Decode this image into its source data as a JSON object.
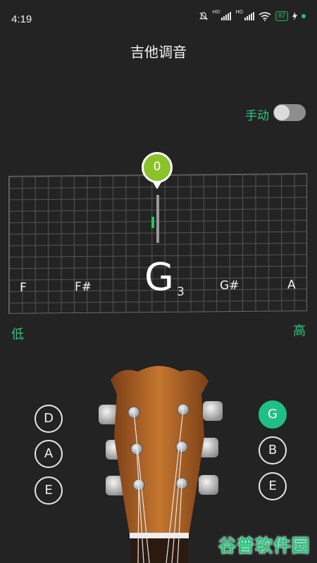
{
  "status": {
    "time": "4:19",
    "hd1": "HD",
    "hd2": "HD",
    "battery": "87"
  },
  "page": {
    "title": "吉他调音"
  },
  "mode": {
    "manual_label": "手动",
    "manual_enabled": false
  },
  "tuner": {
    "cents_offset": "0",
    "notes": [
      "F",
      "F#",
      "G",
      "G#",
      "A"
    ],
    "current_note": "G",
    "current_octave": "3",
    "low_label": "低",
    "high_label": "高"
  },
  "strings": {
    "left": [
      "D",
      "A",
      "E"
    ],
    "right": [
      "G",
      "B",
      "E"
    ],
    "selected": "G"
  },
  "watermark": "谷普软件园",
  "colors": {
    "accent": "#2ec77e",
    "bubble": "#8ac22a",
    "background": "#232323",
    "wood": "#b86a2c"
  }
}
